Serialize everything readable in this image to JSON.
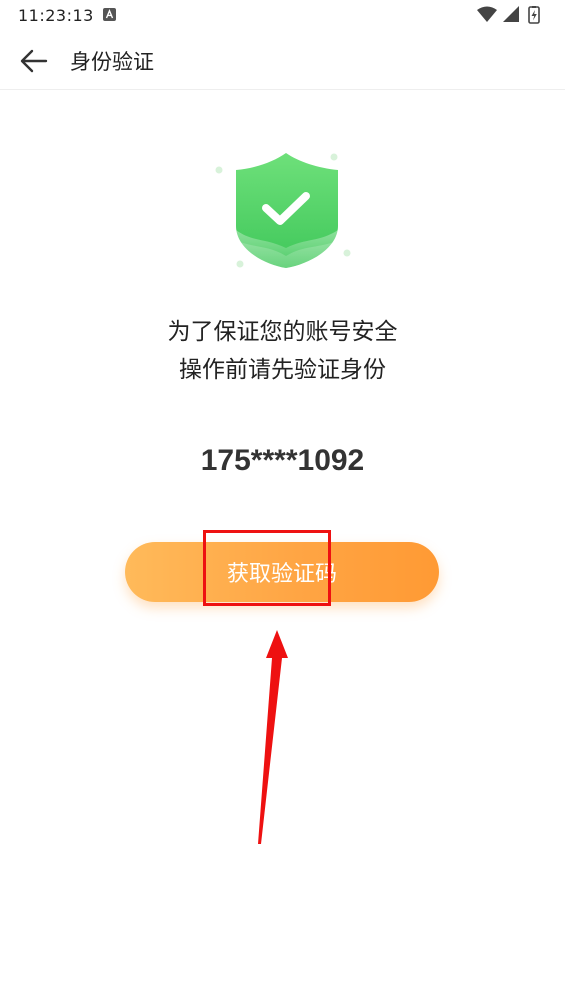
{
  "status_bar": {
    "time": "11:23:13",
    "icons": [
      "keyboard-a-icon",
      "wifi-icon",
      "signal-icon",
      "battery-charging-icon"
    ]
  },
  "header": {
    "back_icon": "arrow-left-icon",
    "title": "身份验证"
  },
  "hero": {
    "icon": "shield-check-icon",
    "colors": {
      "shield_top": "#6EE07A",
      "shield_bottom": "#3FC75A"
    }
  },
  "message": {
    "line1": "为了保证您的账号安全",
    "line2": "操作前请先验证身份"
  },
  "phone": "175****1092",
  "action": {
    "label": "获取验证码",
    "colors": {
      "start": "#FFBA5A",
      "end": "#FF9A34"
    }
  },
  "annotation": {
    "color": "#EE1111"
  }
}
